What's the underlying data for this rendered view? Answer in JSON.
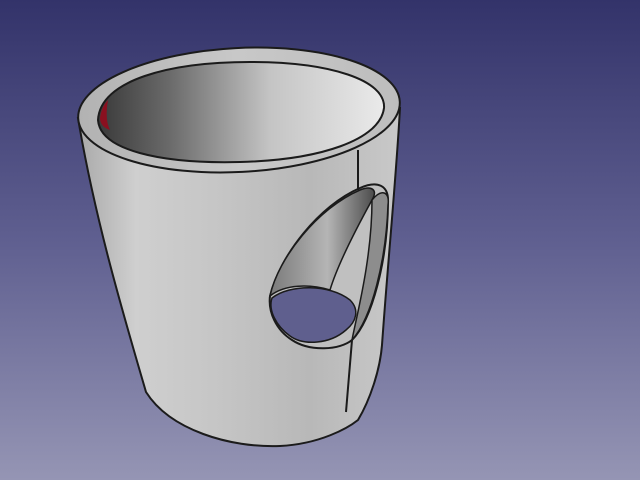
{
  "view": {
    "background_top": "#33336a",
    "background_bottom": "#9595b4",
    "edge_color": "#1b1b1b"
  },
  "model": {
    "shape": "hollow-cylinder-with-side-hole",
    "surface_color": "#c3c3c3",
    "inner_color": "#8a8a8a",
    "accent_color": "#8a1020"
  }
}
